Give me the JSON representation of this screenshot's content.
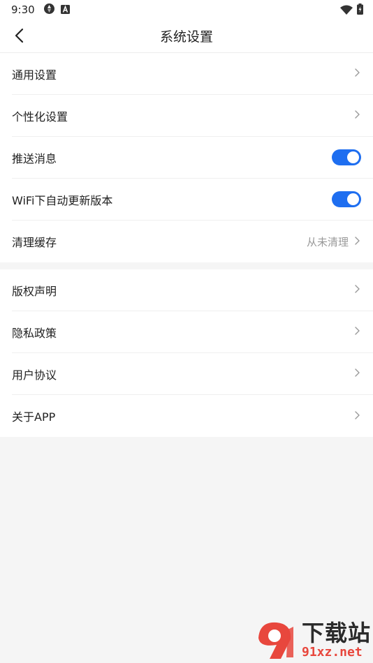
{
  "status_bar": {
    "time": "9:30",
    "left_icons": [
      "aperture-icon",
      "a-box-icon"
    ],
    "right_icons": [
      "wifi-icon",
      "battery-charging-icon"
    ]
  },
  "header": {
    "title": "系统设置",
    "back_icon": "chevron-left-icon"
  },
  "group1": {
    "general": "通用设置",
    "personalization": "个性化设置",
    "push": "推送消息",
    "push_enabled": true,
    "wifi_update": "WiFi下自动更新版本",
    "wifi_update_enabled": true,
    "cache": "清理缓存",
    "cache_value": "从未清理"
  },
  "group2": {
    "copyright": "版权声明",
    "privacy": "隐私政策",
    "agreement": "用户协议",
    "about": "关于APP"
  },
  "colors": {
    "accent": "#1e6ef0",
    "background": "#f5f5f5",
    "watermark_red": "#e8473d"
  },
  "watermark": {
    "title": "下载站",
    "url": "91xz.net"
  }
}
